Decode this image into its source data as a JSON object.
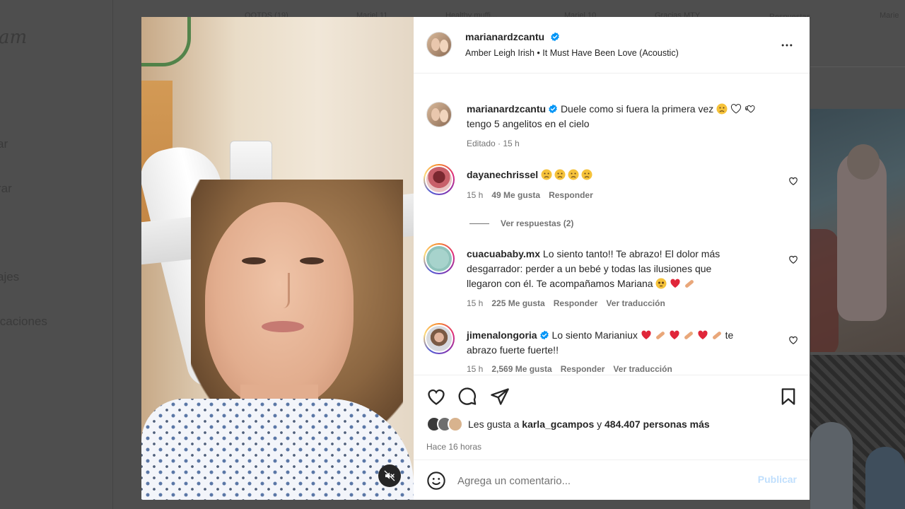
{
  "background": {
    "nav_items": [
      "ar",
      "rar",
      "ajes",
      "icaciones"
    ],
    "logo_partial": "am",
    "highlights": [
      "OOTDS (19)",
      "Mariel 11",
      "Healthy muffi...",
      "Mariel 10",
      "Gracias MTY",
      "Respuestas",
      "Marie"
    ]
  },
  "post": {
    "author": "marianardzcantu",
    "verified": true,
    "music": "Amber Leigh Irish • It Must Have Been Love (Acoustic)",
    "more_icon": "more-dots-icon",
    "caption": {
      "username": "marianardzcantu",
      "line1": "Duele como si fuera la primera vez",
      "line2": "tengo 5 angelitos en el cielo",
      "meta": "Editado · 15 h"
    },
    "comments": [
      {
        "username": "dayanechrissel",
        "verified": false,
        "text": "",
        "time": "15 h",
        "likes": "49 Me gusta",
        "reply": "Responder",
        "translate": ""
      },
      {
        "username": "cuacuababy.mx",
        "verified": false,
        "text_l1": "Lo siento tanto!! Te abrazo! El dolor más",
        "text_l2": "desgarrador: perder a un bebé y todas las ilusiones que",
        "text_l3": "llegaron con él. Te acompañamos Mariana",
        "time": "15 h",
        "likes": "225 Me gusta",
        "reply": "Responder",
        "translate": "Ver traducción"
      },
      {
        "username": "jimenalongoria",
        "verified": true,
        "text_l1": "Lo siento Marianiux",
        "text_l1b": "te",
        "text_l2": "abrazo fuerte fuerte!!",
        "time": "15 h",
        "likes": "2,569 Me gusta",
        "reply": "Responder",
        "translate": "Ver traducción"
      }
    ],
    "view_replies": "Ver respuestas (2)",
    "likes_prefix": "Les gusta a",
    "liked_by": "karla_gcampos",
    "likes_connector": "y",
    "likes_others": "484.407 personas más",
    "time_ago": "Hace 16 horas",
    "comment_placeholder": "Agrega un comentario...",
    "publish_label": "Publicar"
  },
  "colors": {
    "verified": "#0095f6",
    "heart_red": "#ed4956",
    "muted_text": "#737373",
    "publish_disabled": "#c0dffd"
  }
}
